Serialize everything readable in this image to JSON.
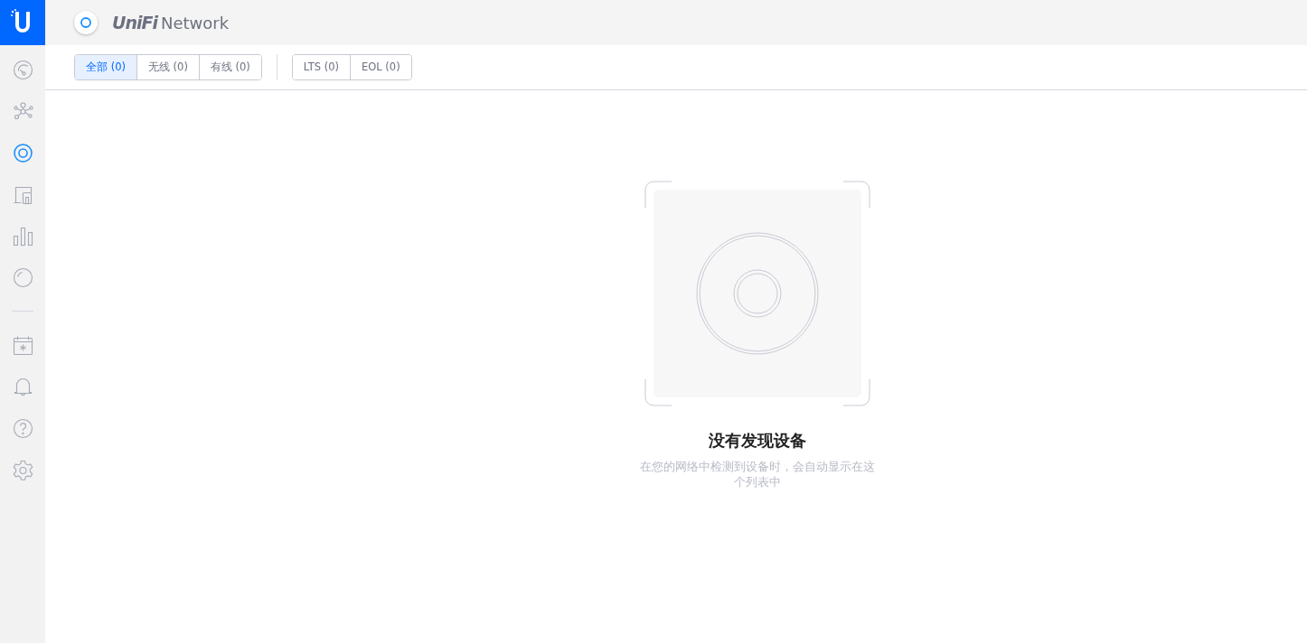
{
  "header": {
    "brand": "UniFi",
    "product": "Network"
  },
  "sidebar": {
    "main": [
      {
        "kind": "dashboard",
        "selected": false
      },
      {
        "kind": "topology",
        "selected": false
      },
      {
        "kind": "devices",
        "selected": true
      },
      {
        "kind": "clients",
        "selected": false
      },
      {
        "kind": "statistics",
        "selected": false
      },
      {
        "kind": "insights",
        "selected": false
      }
    ],
    "secondary": [
      {
        "kind": "events",
        "selected": false
      },
      {
        "kind": "alerts",
        "selected": false
      },
      {
        "kind": "help",
        "selected": false
      },
      {
        "kind": "settings",
        "selected": false
      }
    ]
  },
  "filters": [
    [
      {
        "label": "全部 (0)",
        "selected": true
      },
      {
        "label": "无线 (0)",
        "selected": false
      },
      {
        "label": "有线 (0)",
        "selected": false
      }
    ],
    [
      {
        "label": "LTS (0)",
        "selected": false
      },
      {
        "label": "EOL (0)",
        "selected": false
      }
    ]
  ],
  "empty_state": {
    "title": "没有发现设备",
    "message": "在您的网络中检测到设备时，会自动显示在这个列表中"
  }
}
